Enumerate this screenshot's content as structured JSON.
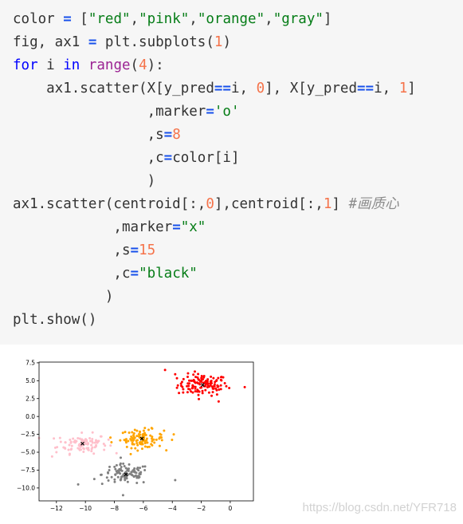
{
  "code": {
    "lines": [
      [
        {
          "t": "color ",
          "c": ""
        },
        {
          "t": "=",
          "c": "op"
        },
        {
          "t": " [",
          "c": ""
        },
        {
          "t": "\"red\"",
          "c": "str"
        },
        {
          "t": ",",
          "c": ""
        },
        {
          "t": "\"pink\"",
          "c": "str"
        },
        {
          "t": ",",
          "c": ""
        },
        {
          "t": "\"orange\"",
          "c": "str"
        },
        {
          "t": ",",
          "c": ""
        },
        {
          "t": "\"gray\"",
          "c": "str"
        },
        {
          "t": "]",
          "c": ""
        }
      ],
      [
        {
          "t": "fig, ax1 ",
          "c": ""
        },
        {
          "t": "=",
          "c": "op"
        },
        {
          "t": " plt.subplots(",
          "c": ""
        },
        {
          "t": "1",
          "c": "num"
        },
        {
          "t": ")",
          "c": ""
        }
      ],
      [
        {
          "t": "for",
          "c": "kw"
        },
        {
          "t": " i ",
          "c": ""
        },
        {
          "t": "in",
          "c": "kw"
        },
        {
          "t": " ",
          "c": ""
        },
        {
          "t": "range",
          "c": "bi"
        },
        {
          "t": "(",
          "c": ""
        },
        {
          "t": "4",
          "c": "num"
        },
        {
          "t": "):",
          "c": ""
        }
      ],
      [
        {
          "t": "    ax1.scatter(X[y_pred",
          "c": ""
        },
        {
          "t": "==",
          "c": "op"
        },
        {
          "t": "i, ",
          "c": ""
        },
        {
          "t": "0",
          "c": "num"
        },
        {
          "t": "], X[y_pred",
          "c": ""
        },
        {
          "t": "==",
          "c": "op"
        },
        {
          "t": "i, ",
          "c": ""
        },
        {
          "t": "1",
          "c": "num"
        },
        {
          "t": "]",
          "c": ""
        }
      ],
      [
        {
          "t": "                ,marker",
          "c": ""
        },
        {
          "t": "=",
          "c": "op"
        },
        {
          "t": "'o'",
          "c": "str"
        }
      ],
      [
        {
          "t": "                ,s",
          "c": ""
        },
        {
          "t": "=",
          "c": "op"
        },
        {
          "t": "8",
          "c": "num"
        }
      ],
      [
        {
          "t": "                ,c",
          "c": ""
        },
        {
          "t": "=",
          "c": "op"
        },
        {
          "t": "color[i]",
          "c": ""
        }
      ],
      [
        {
          "t": "                )",
          "c": ""
        }
      ],
      [
        {
          "t": "ax1.scatter(centroid[:,",
          "c": ""
        },
        {
          "t": "0",
          "c": "num"
        },
        {
          "t": "],centroid[:,",
          "c": ""
        },
        {
          "t": "1",
          "c": "num"
        },
        {
          "t": "] ",
          "c": ""
        },
        {
          "t": "#画质心",
          "c": "cm"
        }
      ],
      [
        {
          "t": "            ,marker",
          "c": ""
        },
        {
          "t": "=",
          "c": "op"
        },
        {
          "t": "\"x\"",
          "c": "str"
        }
      ],
      [
        {
          "t": "            ,s",
          "c": ""
        },
        {
          "t": "=",
          "c": "op"
        },
        {
          "t": "15",
          "c": "num"
        }
      ],
      [
        {
          "t": "            ,c",
          "c": ""
        },
        {
          "t": "=",
          "c": "op"
        },
        {
          "t": "\"black\"",
          "c": "str"
        }
      ],
      [
        {
          "t": "           )",
          "c": ""
        }
      ],
      [
        {
          "t": "plt.show()",
          "c": ""
        }
      ]
    ]
  },
  "chart_data": {
    "type": "scatter",
    "title": "",
    "xlabel": "",
    "ylabel": "",
    "xlim": [
      -13.2,
      1.6
    ],
    "ylim": [
      -11.8,
      7.6
    ],
    "xticks": [
      -12,
      -10,
      -8,
      -6,
      -4,
      -2,
      0
    ],
    "yticks": [
      7.5,
      5.0,
      2.5,
      0.0,
      -2.5,
      -5.0,
      -7.5,
      -10.0
    ],
    "xtick_labels": [
      "−12",
      "−10",
      "−8",
      "−6",
      "−4",
      "−2",
      "0"
    ],
    "ytick_labels": [
      "7.5",
      "5.0",
      "2.5",
      "0.0",
      "−2.5",
      "−5.0",
      "−7.5",
      "−10.0"
    ],
    "grid": false,
    "clusters": [
      {
        "color": "#ff0000",
        "center": [
          -1.9,
          4.4
        ],
        "spread": [
          1.15,
          1.0
        ],
        "count": 120,
        "outliers": [
          [
            -4.5,
            6.5
          ],
          [
            -3.8,
            5.9
          ],
          [
            1.0,
            4.1
          ],
          [
            -0.8,
            2.1
          ]
        ]
      },
      {
        "color": "#ffc0cb",
        "center": [
          -10.2,
          -3.8
        ],
        "spread": [
          1.15,
          0.9
        ],
        "count": 100,
        "outliers": [
          [
            -12.3,
            -5.6
          ],
          [
            -12.0,
            -5.0
          ]
        ]
      },
      {
        "color": "#ffa500",
        "center": [
          -6.1,
          -3.1
        ],
        "spread": [
          1.0,
          0.85
        ],
        "count": 100,
        "outliers": [
          [
            -3.9,
            -2.5
          ],
          [
            -8.2,
            -3.6
          ]
        ]
      },
      {
        "color": "#808080",
        "center": [
          -7.2,
          -8.1
        ],
        "spread": [
          1.1,
          0.95
        ],
        "count": 100,
        "outliers": [
          [
            -3.8,
            -8.9
          ],
          [
            -10.5,
            -9.5
          ],
          [
            -7.4,
            -11.0
          ]
        ]
      }
    ],
    "centroids": {
      "color": "#000000",
      "marker": "x",
      "points": [
        [
          -1.9,
          4.4
        ],
        [
          -10.2,
          -3.8
        ],
        [
          -6.1,
          -3.1
        ],
        [
          -7.2,
          -8.1
        ]
      ]
    }
  },
  "watermark": "https://blog.csdn.net/YFR718"
}
